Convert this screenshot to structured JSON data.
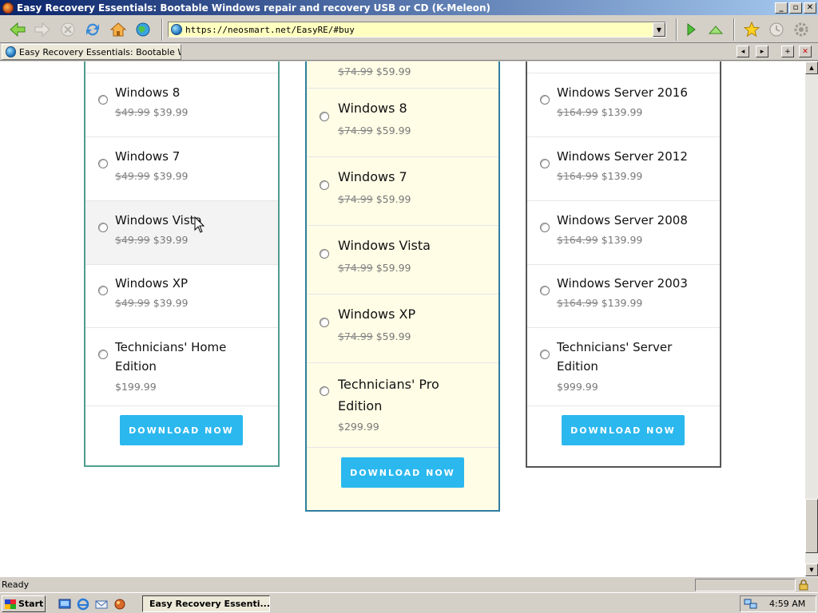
{
  "window": {
    "title": "Easy Recovery Essentials: Bootable Windows repair and recovery USB or CD (K-Meleon)",
    "minimize": "_",
    "maximize": "▫",
    "close": "✕"
  },
  "navbar": {
    "url": "https://neosmart.net/EasyRE/#buy"
  },
  "tab": {
    "label": "Easy Recovery Essentials: Bootable Wi..."
  },
  "columns": [
    {
      "items": [
        {
          "name": "Windows 8",
          "old_price": "$49.99",
          "price": "$39.99"
        },
        {
          "name": "Windows 7",
          "old_price": "$49.99",
          "price": "$39.99"
        },
        {
          "name": "Windows Vista",
          "old_price": "$49.99",
          "price": "$39.99"
        },
        {
          "name": "Windows XP",
          "old_price": "$49.99",
          "price": "$39.99"
        },
        {
          "name": "Technicians' Home Edition",
          "old_price": "",
          "price": "$199.99"
        }
      ],
      "button": "DOWNLOAD NOW"
    },
    {
      "top_old_price": "$74.99",
      "top_price": "$59.99",
      "items": [
        {
          "name": "Windows 8",
          "old_price": "$74.99",
          "price": "$59.99"
        },
        {
          "name": "Windows 7",
          "old_price": "$74.99",
          "price": "$59.99"
        },
        {
          "name": "Windows Vista",
          "old_price": "$74.99",
          "price": "$59.99"
        },
        {
          "name": "Windows XP",
          "old_price": "$74.99",
          "price": "$59.99"
        },
        {
          "name": "Technicians' Pro Edition",
          "old_price": "",
          "price": "$299.99"
        }
      ],
      "button": "DOWNLOAD NOW"
    },
    {
      "items": [
        {
          "name": "Windows Server 2016",
          "old_price": "$164.99",
          "price": "$139.99"
        },
        {
          "name": "Windows Server 2012",
          "old_price": "$164.99",
          "price": "$139.99"
        },
        {
          "name": "Windows Server 2008",
          "old_price": "$164.99",
          "price": "$139.99"
        },
        {
          "name": "Windows Server 2003",
          "old_price": "$164.99",
          "price": "$139.99"
        },
        {
          "name": "Technicians' Server Edition",
          "old_price": "",
          "price": "$999.99"
        }
      ],
      "button": "DOWNLOAD NOW"
    }
  ],
  "status": {
    "text": "Ready"
  },
  "taskbar": {
    "start": "Start",
    "task": "Easy Recovery Essenti...",
    "clock": "4:59 AM"
  },
  "colors": {
    "accent_button": "#2bb8ee",
    "card1_border": "#4f9d8f",
    "card2_border": "#2f7ea0",
    "card2_bg": "#fffde6",
    "card3_border": "#555555",
    "url_bg": "#ffffc0"
  },
  "icons": [
    "back-arrow-icon",
    "forward-arrow-icon",
    "stop-icon",
    "reload-icon",
    "home-icon",
    "globe-icon",
    "go-icon",
    "up-icon",
    "star-icon",
    "history-icon",
    "settings-icon"
  ]
}
